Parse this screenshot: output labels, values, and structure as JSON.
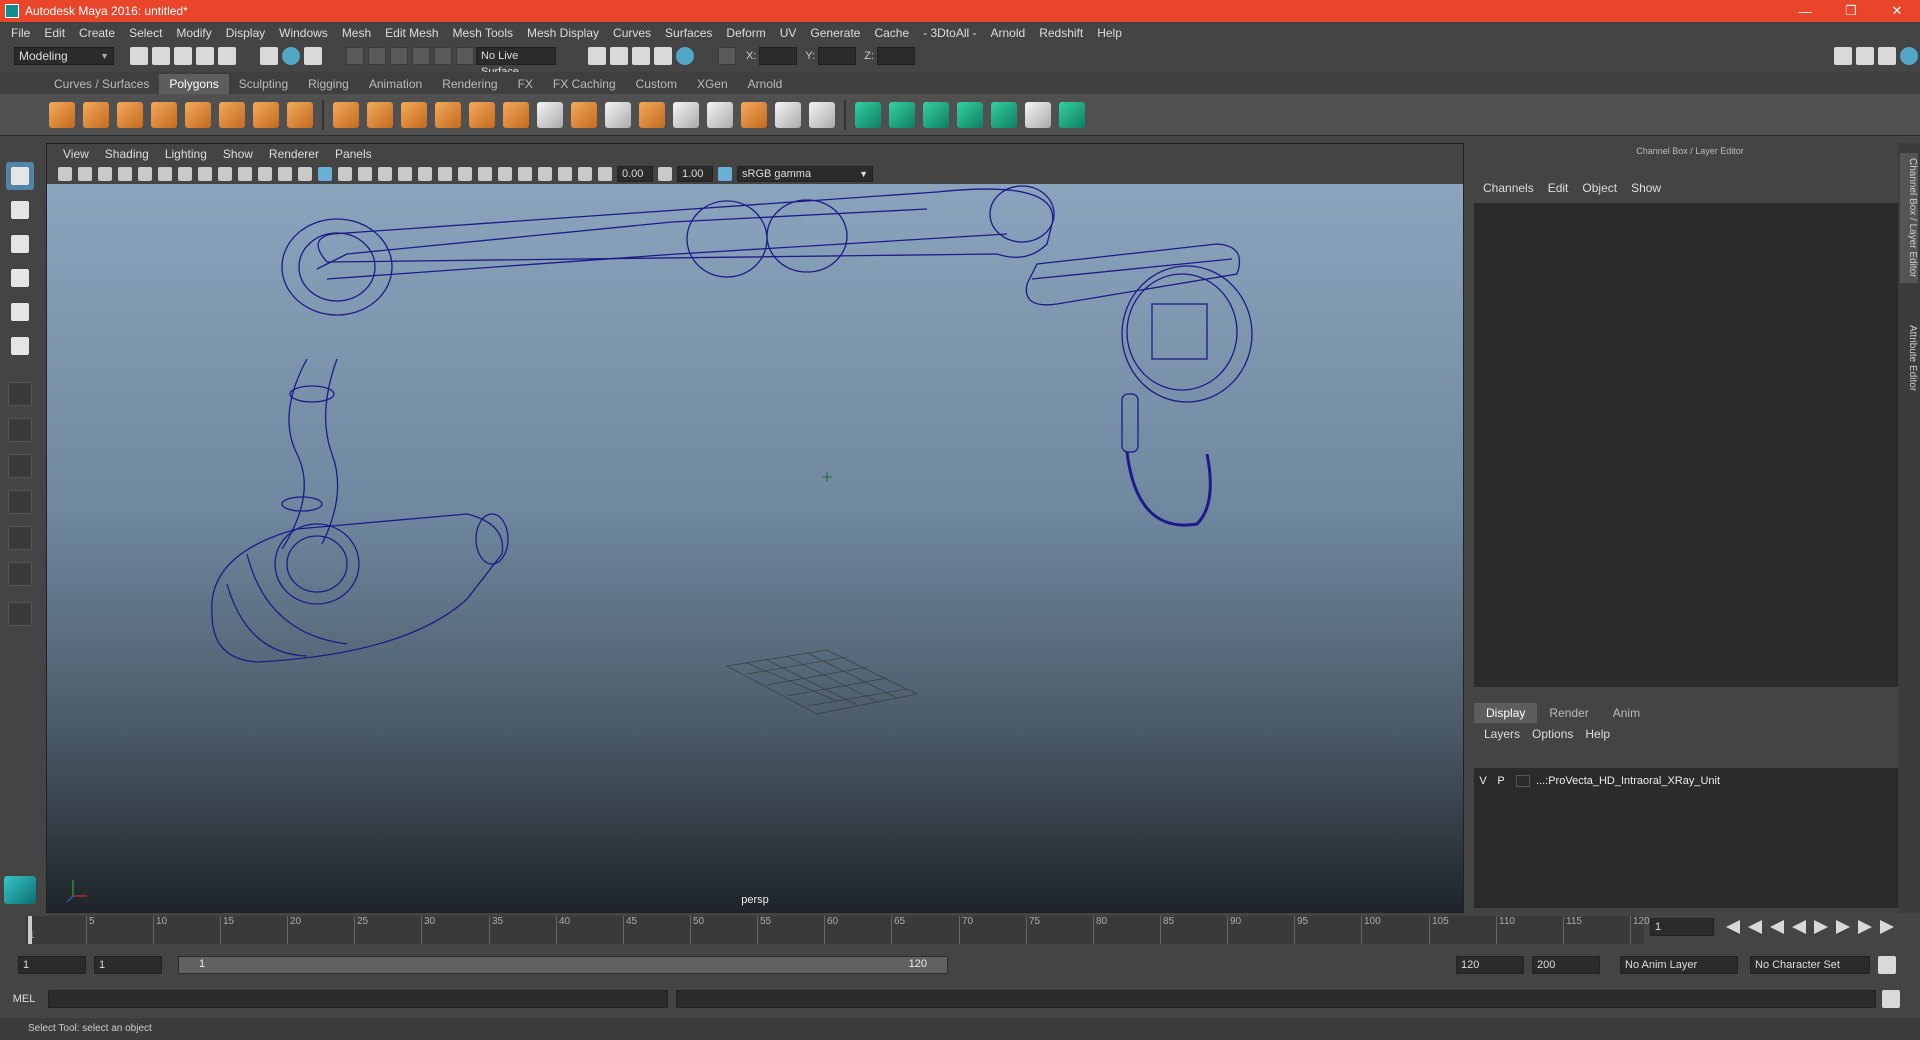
{
  "app": {
    "title": "Autodesk Maya 2016: untitled*"
  },
  "menubar": [
    "File",
    "Edit",
    "Create",
    "Select",
    "Modify",
    "Display",
    "Windows",
    "Mesh",
    "Edit Mesh",
    "Mesh Tools",
    "Mesh Display",
    "Curves",
    "Surfaces",
    "Deform",
    "UV",
    "Generate",
    "Cache",
    "- 3DtoAll -",
    "Arnold",
    "Redshift",
    "Help"
  ],
  "status": {
    "mode": "Modeling",
    "live_surface": "No Live Surface",
    "x_label": "X:",
    "y_label": "Y:",
    "z_label": "Z:"
  },
  "shelf_tabs": [
    "Curves / Surfaces",
    "Polygons",
    "Sculpting",
    "Rigging",
    "Animation",
    "Rendering",
    "FX",
    "FX Caching",
    "Custom",
    "XGen",
    "Arnold"
  ],
  "shelf_active": "Polygons",
  "viewport": {
    "menu": [
      "View",
      "Shading",
      "Lighting",
      "Show",
      "Renderer",
      "Panels"
    ],
    "exposure": "0.00",
    "gamma": "1.00",
    "colorspace": "sRGB gamma",
    "camera": "persp"
  },
  "right_panel": {
    "title": "Channel Box / Layer Editor",
    "menu": [
      "Channels",
      "Edit",
      "Object",
      "Show"
    ],
    "tabs": [
      "Display",
      "Render",
      "Anim"
    ],
    "active_tab": "Display",
    "layer_menu": [
      "Layers",
      "Options",
      "Help"
    ],
    "layer": {
      "v": "V",
      "p": "P",
      "name": "...:ProVecta_HD_Intraoral_XRay_Unit"
    },
    "side_tabs": [
      "Channel Box / Layer Editor",
      "Attribute Editor"
    ]
  },
  "timeline": {
    "ticks": [
      "5",
      "10",
      "15",
      "20",
      "25",
      "30",
      "35",
      "40",
      "45",
      "50",
      "55",
      "60",
      "65",
      "70",
      "75",
      "80",
      "85",
      "90",
      "95",
      "100",
      "105",
      "110",
      "115",
      "120"
    ],
    "start_label": "1",
    "current_frame": "1"
  },
  "range": {
    "start": "1",
    "playback_start": "1",
    "slider_start": "1",
    "slider_end": "120",
    "playback_end": "120",
    "end": "200",
    "anim_layer": "No Anim Layer",
    "char_set": "No Character Set"
  },
  "cmd": {
    "label": "MEL"
  },
  "help": {
    "text": "Select Tool: select an object"
  }
}
